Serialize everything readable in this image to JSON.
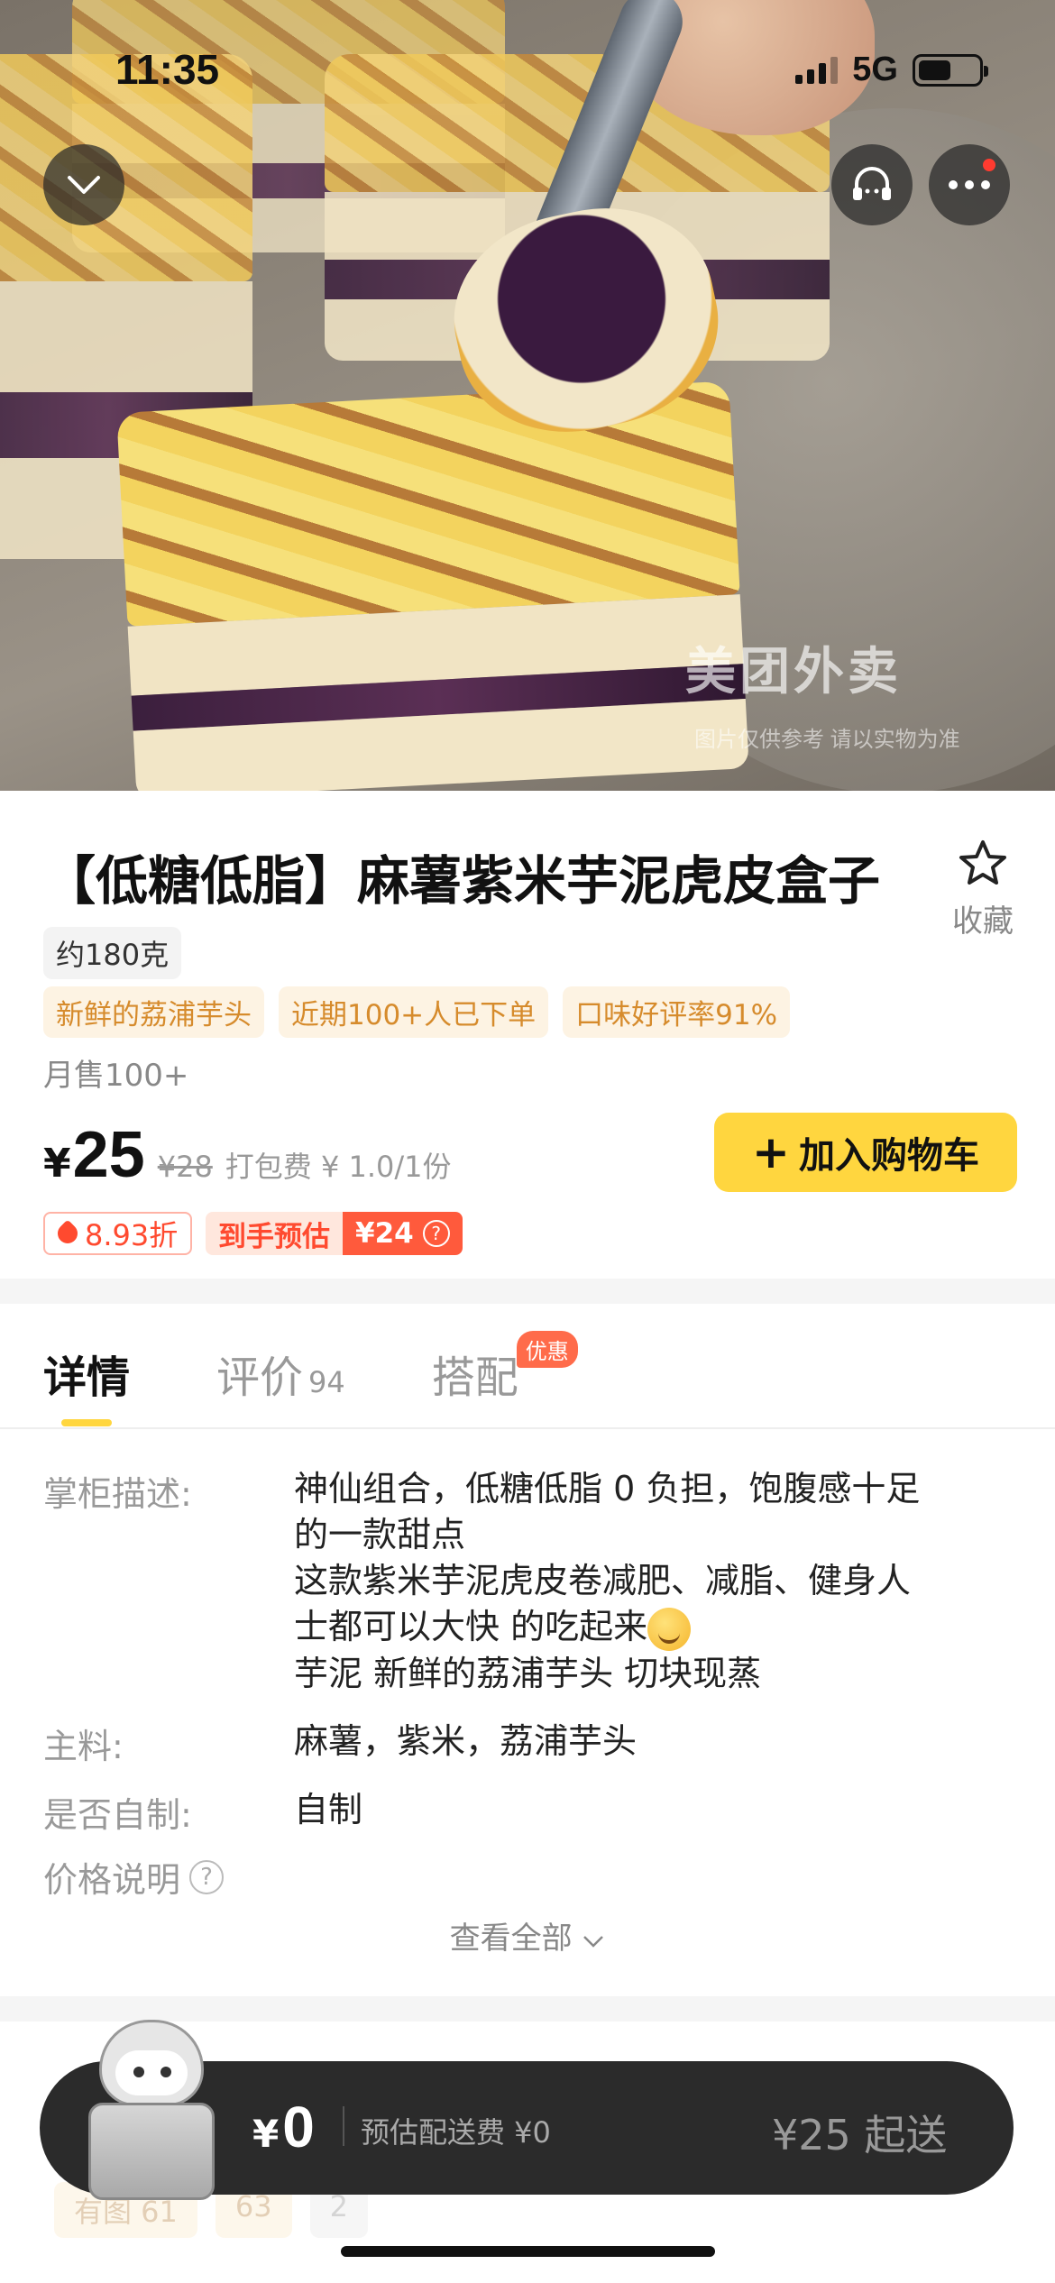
{
  "status": {
    "time": "11:35",
    "network": "5G",
    "battery_level": 0.55
  },
  "hero": {
    "watermark": "美团外卖",
    "watermark_sub": "图片仅供参考 请以实物为准"
  },
  "product": {
    "title": "【低糖低脂】麻薯紫米芋泥虎皮盒子",
    "favorite_label": "收藏",
    "weight": "约180克",
    "tags": [
      "新鲜的荔浦芋头",
      "近期100+人已下单",
      "口味好评率91%"
    ],
    "monthly_sales": "月售100+",
    "price_symbol": "¥",
    "price": "25",
    "original_price": "¥28",
    "packing_fee": "打包费 ¥ 1.0/1份",
    "add_to_cart": "加入购物车",
    "discount": "8.93折",
    "estimate_label": "到手预估",
    "estimate_price": "¥24"
  },
  "tabs": [
    {
      "label": "详情"
    },
    {
      "label": "评价",
      "count": "94"
    },
    {
      "label": "搭配",
      "badge": "优惠"
    }
  ],
  "details": {
    "desc_label": "掌柜描述:",
    "desc_lines": [
      "神仙组合，低糖低脂 0 负担，饱腹感十足",
      "的一款甜点",
      "这款紫米芋泥虎皮卷减肥、减脂、健身人",
      "士都可以大快 的吃起来",
      "芋泥 新鲜的荔浦芋头 切块现蒸"
    ],
    "main_label": "主料:",
    "main_value": "麻薯，紫米，荔浦芋头",
    "homemade_label": "是否自制:",
    "homemade_value": "自制",
    "price_note_label": "价格说明",
    "view_all": "查看全部"
  },
  "reviews_preview": {
    "chips": [
      "有图 61",
      "63",
      "2"
    ]
  },
  "cart": {
    "symbol": "¥",
    "total": "0",
    "delivery_fee": "预估配送费 ¥0",
    "min_order": "¥25 起送"
  },
  "colors": {
    "accent": "#FFD63F",
    "promo": "#FF4A2F",
    "tag_text": "#D68B2C",
    "tag_bg": "#FDF3E3",
    "cart_bar": "#2B2B2B"
  }
}
